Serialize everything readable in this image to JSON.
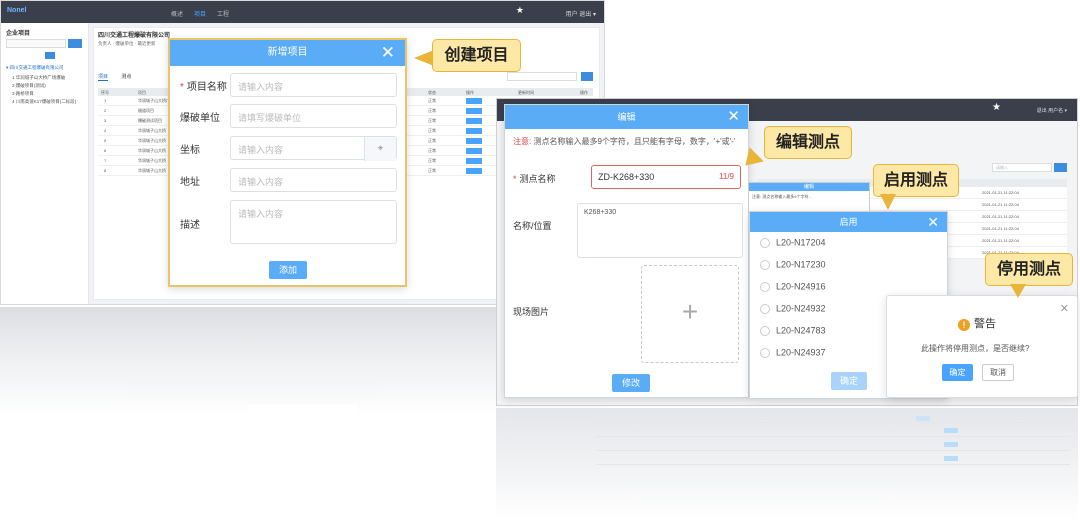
{
  "screen1": {
    "topbar": {
      "logo": "Nonel",
      "nav": [
        "概述",
        "项目",
        "工程"
      ],
      "user": "用户 退出 ▾"
    },
    "sidebar": {
      "title": "企业项目",
      "tree": [
        "▾ 四川交通工程爆破有限公司",
        "1 华润城子山大桥广场爆破",
        "2 爆破项目(测试)",
        "3 路桥项目",
        "4 川南高速K17爆破项目(二标段)"
      ]
    },
    "main": {
      "company_title": "四川交通工程爆破有限公司",
      "meta": "负责人 · 爆破单位 · 最近更新",
      "tabs": [
        "项目",
        "测点"
      ],
      "columns": [
        "序号",
        "项目",
        "状态",
        "操作",
        "更新时间",
        "操作"
      ],
      "row_names": [
        "华润城子山大桥广场",
        "隧道项目",
        "爆破测试项目",
        "华润城子山大桥",
        "华润城子山大桥",
        "华润城子山大桥",
        "华润城子山大桥",
        "华润城子山大桥"
      ],
      "row_status": "正常",
      "row_action": "详情"
    },
    "dialog": {
      "title": "新增项目",
      "close": "✕",
      "fields": [
        {
          "label": "项目名称",
          "placeholder": "请输入内容",
          "required": true
        },
        {
          "label": "爆破单位",
          "placeholder": "请填写爆破单位",
          "required": false
        },
        {
          "label": "坐标",
          "placeholder": "请输入内容",
          "required": false
        },
        {
          "label": "地址",
          "placeholder": "请输入内容",
          "required": false
        },
        {
          "label": "描述",
          "placeholder": "请输入内容",
          "required": false
        }
      ],
      "location_icon": "⌖",
      "submit": "添加"
    },
    "callout": "创建项目"
  },
  "screen2": {
    "star_icon": "★",
    "user": "退出  用户名 ▾",
    "table_search_placeholder": "请输入",
    "dates": [
      "2021-01-21 11:22:04",
      "2021-01-21 11:22:04",
      "2021-01-21 11:22:04",
      "2021-01-21 11:22:04",
      "2021-01-21 11:22:04",
      "2021-01-21 11:22:04"
    ],
    "edit_dialog": {
      "title": "编辑",
      "close": "✕",
      "note_label": "注意:",
      "note_text": "测点名称输入最多9个字符，且只能有字母，数字，'+'或'-'",
      "name_label": "测点名称",
      "name_value": "ZD-K268+330",
      "name_counter": "11/9",
      "location_label": "名称/位置",
      "location_value": "K268+330",
      "photo_label": "现场图片",
      "upload_icon": "+",
      "submit": "修改"
    },
    "mini_dialog": {
      "title": "编辑",
      "text": "注意: 测点名称输入最多9个字符..."
    },
    "enable_dialog": {
      "title": "启用",
      "close": "✕",
      "options": [
        "L20-N17204",
        "L20-N17230",
        "L20-N24916",
        "L20-N24932",
        "L20-N24783",
        "L20-N24937"
      ],
      "submit": "确定"
    },
    "warn_dialog": {
      "title": "警告",
      "icon": "!",
      "close": "✕",
      "message": "此操作将停用测点，是否继续?",
      "ok": "确定",
      "cancel": "取消"
    },
    "callouts": [
      "编辑测点",
      "启用测点",
      "停用测点"
    ]
  },
  "colors": {
    "accent_blue": "#5aacf6",
    "callout_bg": "#fde8a6",
    "callout_border": "#e8b53a",
    "required": "#e04040",
    "topbar": "#3a3f4b"
  }
}
